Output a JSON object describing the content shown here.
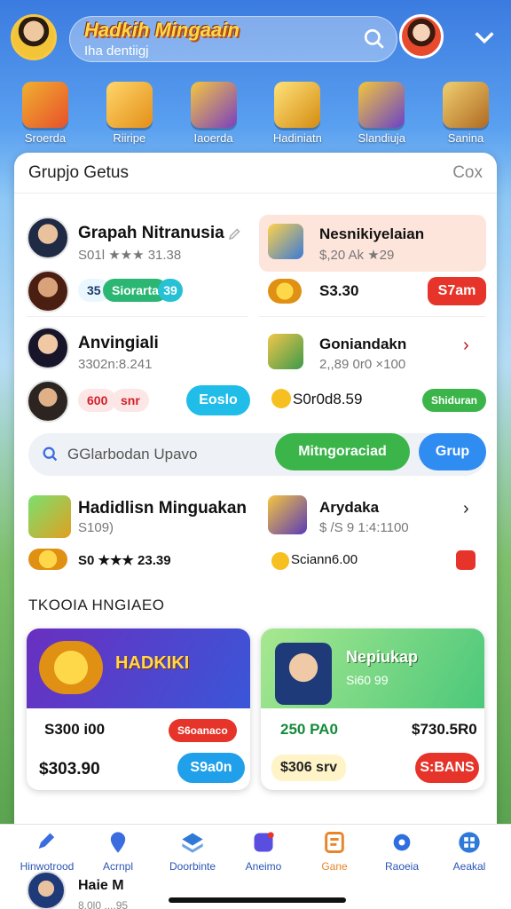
{
  "header": {
    "title": "Hadkih Mingaain",
    "search_placeholder": "Iha dentiigj"
  },
  "categories": [
    {
      "label": "Sroerda",
      "icon": "shopping-bag-icon",
      "color": "#e8502a"
    },
    {
      "label": "Riiripe",
      "icon": "sword-icon",
      "color": "#f0a020"
    },
    {
      "label": "Iaoerda",
      "icon": "treasure-icon",
      "color": "#7a3fc0"
    },
    {
      "label": "Hadiniatn",
      "icon": "trophy-icon",
      "color": "#e9a81e"
    },
    {
      "label": "Slandiuja",
      "icon": "shield-icon",
      "color": "#6a42c8"
    },
    {
      "label": "Sanina",
      "icon": "frame-icon",
      "color": "#c9852c"
    }
  ],
  "panel": {
    "title": "Grupjo Getus",
    "close": "Cox",
    "left_items": [
      {
        "title": "Grapah Nitranusia",
        "sub": "S01l ★★★ 31.38",
        "chips": [
          "35",
          "Siorarta",
          "39"
        ],
        "name": "left-item-1"
      },
      {
        "title": "Anvingiali",
        "sub": "3302n:8.241",
        "chips": [
          "600",
          "snr"
        ],
        "button": "Eoslo",
        "name": "left-item-2"
      }
    ],
    "right_items": [
      {
        "title": "Nesnikiyelaian",
        "sub": "$,20 Ak ★29",
        "value": "S3.30",
        "button": "S7am"
      },
      {
        "title": "Goniandakn",
        "sub": "2,,89 0r0 ×100",
        "value": "S0r0d8.59",
        "badge": "Shiduran"
      }
    ],
    "search": {
      "text": "GGlarbodan Upavo",
      "primary_button": "Mitngoraciad",
      "secondary_button": "Grup"
    },
    "promo_items": [
      {
        "title": "Hadidlisn Minguakan",
        "sub": "S109)",
        "value": "S0 ★★★ 23.39"
      },
      {
        "title": "Arydaka",
        "sub": "$ /S 9 1:4:1100",
        "value": "Sciann6.00"
      }
    ],
    "section_title": "TKOOIA HNGIAEO",
    "cards": [
      {
        "banner_title": "HADKIKI",
        "price_top": "S300 i00",
        "badge": "S6oanaco",
        "price_bottom": "$303.90",
        "button": "S9a0n"
      },
      {
        "banner_title": "Nepiukap",
        "banner_sub": "Si60 99",
        "price_top": "250 PA0",
        "price_top_right": "$730.5R0",
        "price_bottom": "$306 srv",
        "button": "S:BANS"
      }
    ]
  },
  "bottom_nav": [
    {
      "label": "Hinwotrood",
      "icon": "pencil-icon"
    },
    {
      "label": "Acrnpl",
      "icon": "location-icon"
    },
    {
      "label": "Doorbinte",
      "icon": "layers-icon"
    },
    {
      "label": "Aneimo",
      "icon": "edit-icon"
    },
    {
      "label": "Gane",
      "icon": "document-icon"
    },
    {
      "label": "Raoeia",
      "icon": "gear-icon"
    },
    {
      "label": "Aeakal",
      "icon": "grid-icon"
    }
  ],
  "user": {
    "name": "Haie M",
    "sub": "8.0l0 ....95"
  },
  "colors": {
    "green": "#3bb54a",
    "blue": "#2f8cf0",
    "red": "#e6342a",
    "coin": "#f5b620"
  }
}
